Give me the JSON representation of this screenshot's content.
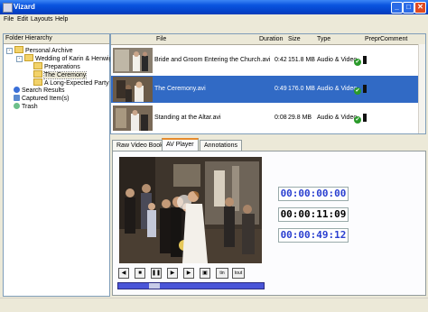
{
  "window": {
    "title": "Vizard",
    "minimize": "_",
    "maximize": "□",
    "close": "✕"
  },
  "menu": [
    "File",
    "Edit",
    "Layouts",
    "Help"
  ],
  "folder_hierarchy": {
    "header": "Folder Hierarchy",
    "items": [
      {
        "label": "Personal Archive",
        "toggle": "-"
      },
      {
        "label": "Wedding of Karin & Henwig",
        "toggle": "-"
      },
      {
        "label": "Preparations"
      },
      {
        "label": "The Ceremony",
        "selected": true
      },
      {
        "label": "A Long-Expected Party"
      },
      {
        "label": "Search Results"
      },
      {
        "label": "Captured Item(s)"
      },
      {
        "label": "Trash"
      }
    ]
  },
  "file_list": {
    "columns": [
      "File",
      "Duration",
      "Size",
      "Type",
      "Prepr",
      "Comment"
    ],
    "rows": [
      {
        "file": "Bride and Groom Entering the Church.avi",
        "duration": "0:42",
        "size": "151.8 MB",
        "type": "Audio & Video",
        "selected": false
      },
      {
        "file": "The Ceremony.avi",
        "duration": "0:49",
        "size": "176.0 MB",
        "type": "Audio & Video",
        "selected": true
      },
      {
        "file": "Standing at the Altar.avi",
        "duration": "0:08",
        "size": "29.8 MB",
        "type": "Audio & Video",
        "selected": false
      }
    ]
  },
  "tabs": [
    "Raw Video Book",
    "AV Player",
    "Annotations"
  ],
  "active_tab": "AV Player",
  "timecodes": [
    "00:00:00:00",
    "00:00:11:09",
    "00:00:49:12"
  ],
  "timecode_colors": [
    "#2a3fd0",
    "#000000",
    "#2a3fd0"
  ],
  "controls": [
    {
      "name": "rewind-start-button",
      "glyph": "◀"
    },
    {
      "name": "stop-button",
      "glyph": "■"
    },
    {
      "name": "pause-button",
      "glyph": "❚❚"
    },
    {
      "name": "play-button",
      "glyph": "▶"
    },
    {
      "name": "forward-end-button",
      "glyph": "▶"
    },
    {
      "name": "snapshot-button",
      "glyph": "▣"
    },
    {
      "name": "tin-button",
      "glyph": "tin"
    },
    {
      "name": "tout-button",
      "glyph": "tout"
    }
  ],
  "playback_progress": 0.23,
  "accent_colors": {
    "selection": "#316ac5",
    "titlebar": "#0a55e0"
  }
}
